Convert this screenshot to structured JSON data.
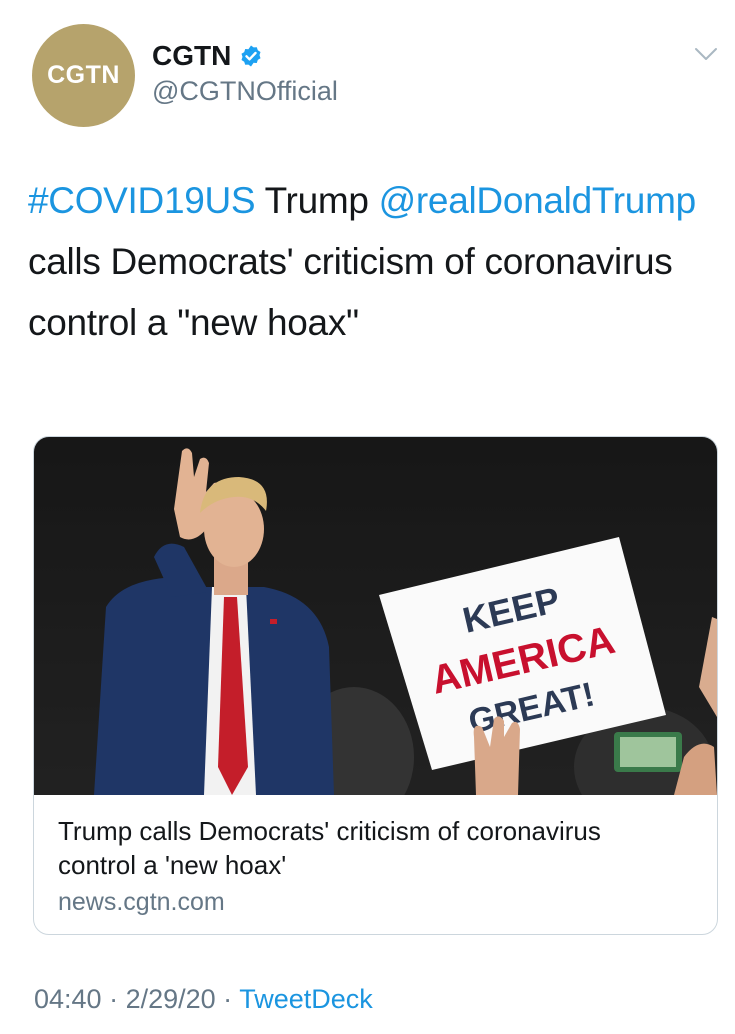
{
  "author": {
    "avatar_text": "CGTN",
    "display_name": "CGTN",
    "handle": "@CGTNOfficial",
    "verified": true
  },
  "tweet": {
    "hashtag": "#COVID19US",
    "text_1": " Trump ",
    "mention": "@realDonaldTrump",
    "text_2": " calls Democrats' criticism of coronavirus control a \"new hoax\""
  },
  "card": {
    "image_sign_line_1": "KEEP",
    "image_sign_line_2": "AMERICA",
    "image_sign_line_3": "GREAT!",
    "title": "Trump calls Democrats' criticism of coronavirus control a 'new hoax'",
    "domain": "news.cgtn.com"
  },
  "footer": {
    "time": "04:40",
    "separator": " · ",
    "date": "2/29/20",
    "source": "TweetDeck"
  },
  "colors": {
    "link": "#1b95e0",
    "secondary_text": "#657786",
    "avatar_gold": "#b6a36c",
    "sign_red": "#c8102e"
  },
  "icons": {
    "verified": "verified-badge-icon",
    "more": "chevron-down-icon"
  }
}
